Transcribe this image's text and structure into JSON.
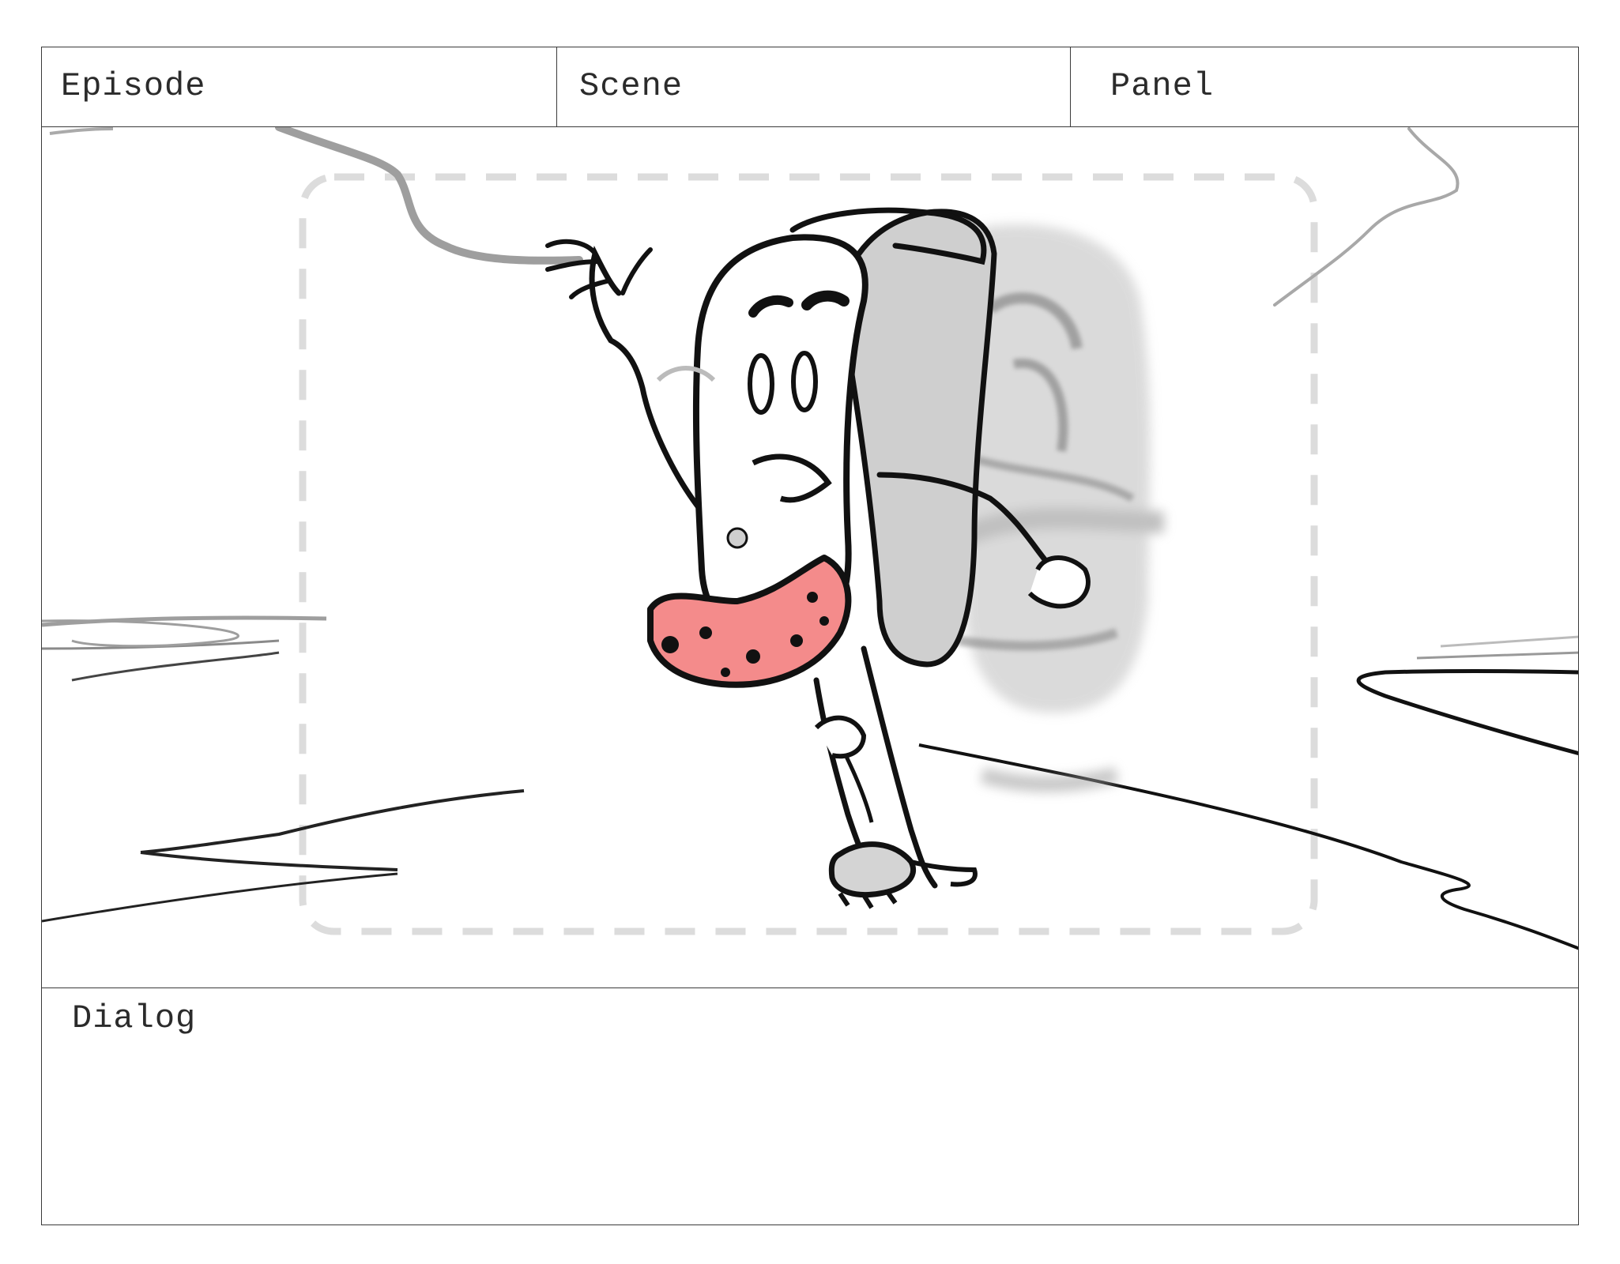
{
  "header": {
    "episode_label": "Episode",
    "scene_label": "Scene",
    "panel_label": "Panel"
  },
  "artwork": {
    "description_icon": "storyboard-sketch",
    "accent_color": "#f08080",
    "safe_frame_color": "#d9d9d9"
  },
  "dialog": {
    "label": "Dialog"
  }
}
